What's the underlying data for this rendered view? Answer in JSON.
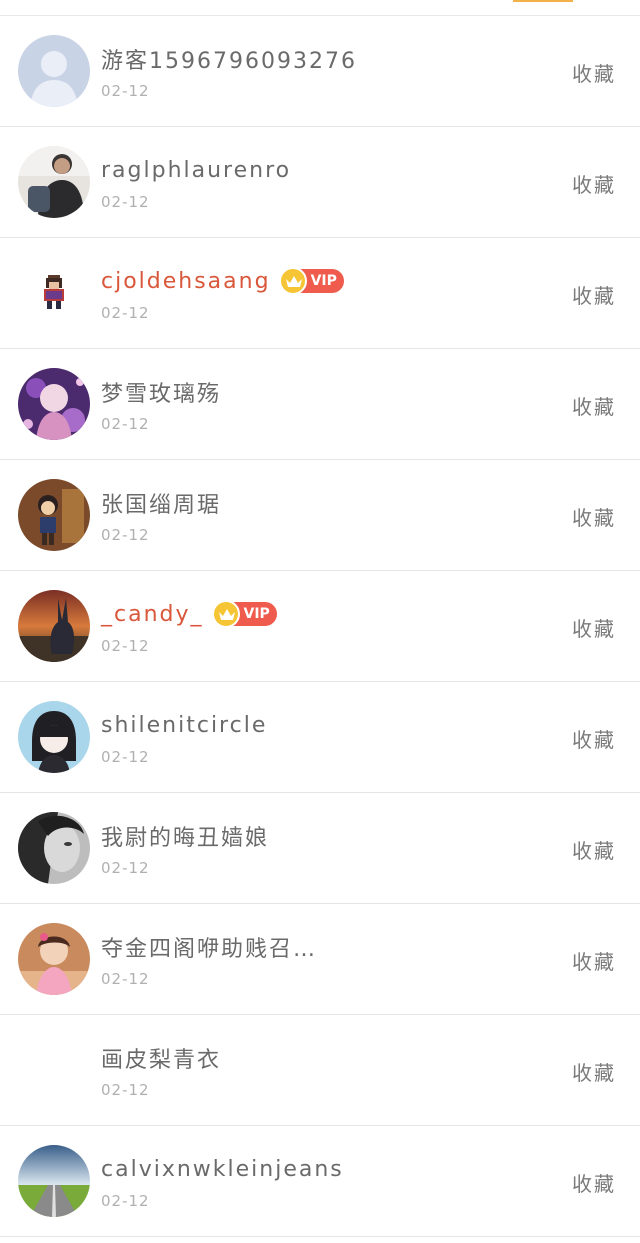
{
  "colors": {
    "accent": "#f3b14a",
    "vip_name": "#d9573a",
    "vip_badge": "#ef5b4c",
    "crown": "#f6c535"
  },
  "vip_label": "VIP",
  "action_label": "收藏",
  "rows": [
    {
      "name": "游客1596796093276",
      "date": "02-12",
      "avatar": "default-user-avatar",
      "vip": false
    },
    {
      "name": "raglphlaurenro",
      "date": "02-12",
      "avatar": "photo-avatar",
      "vip": false
    },
    {
      "name": "cjoldehsaang",
      "date": "02-12",
      "avatar": "pixel-character-avatar",
      "vip": true
    },
    {
      "name": "梦雪玫璃殇",
      "date": "02-12",
      "avatar": "anime-girl-avatar",
      "vip": false
    },
    {
      "name": "张国缁周琚",
      "date": "02-12",
      "avatar": "cartoon-boy-avatar",
      "vip": false
    },
    {
      "name": "_candy_",
      "date": "02-12",
      "avatar": "sunset-rabbit-avatar",
      "vip": true
    },
    {
      "name": "shilenitcircle",
      "date": "02-12",
      "avatar": "anime-girl-blue-avatar",
      "vip": false
    },
    {
      "name": "我尉的晦丑嫱娘",
      "date": "02-12",
      "avatar": "grayscale-portrait-avatar",
      "vip": false
    },
    {
      "name": "夺金四阁咿助贱召…",
      "date": "02-12",
      "avatar": "child-photo-avatar",
      "vip": false
    },
    {
      "name": "画皮梨青衣",
      "date": "02-12",
      "avatar": "",
      "vip": false
    },
    {
      "name": "calvixnwkleinjeans",
      "date": "02-12",
      "avatar": "road-landscape-avatar",
      "vip": false
    }
  ]
}
